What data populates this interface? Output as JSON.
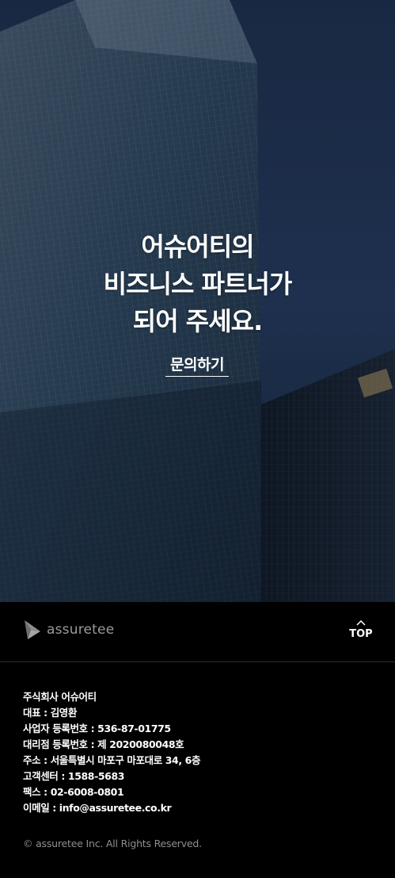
{
  "hero": {
    "title_lines": [
      "어슈어티의",
      "비즈니스 파트너가",
      "되어 주세요."
    ],
    "cta_label": "문의하기"
  },
  "footer": {
    "logo_text": "assuretee",
    "top_label": "TOP",
    "company_lines": [
      "주식회사 어슈어티",
      "대표 : 김영환",
      "사업자 등록번호 : 536-87-01775",
      "대리점 등록번호 : 제 2020080048호",
      "주소 : 서울특별시 마포구 마포대로 34, 6층",
      "고객센터 : 1588-5683",
      "팩스 : 02-6008-0801",
      "이메일 : info@assuretee.co.kr"
    ],
    "copyright": "© assuretee Inc. All Rights Reserved."
  }
}
